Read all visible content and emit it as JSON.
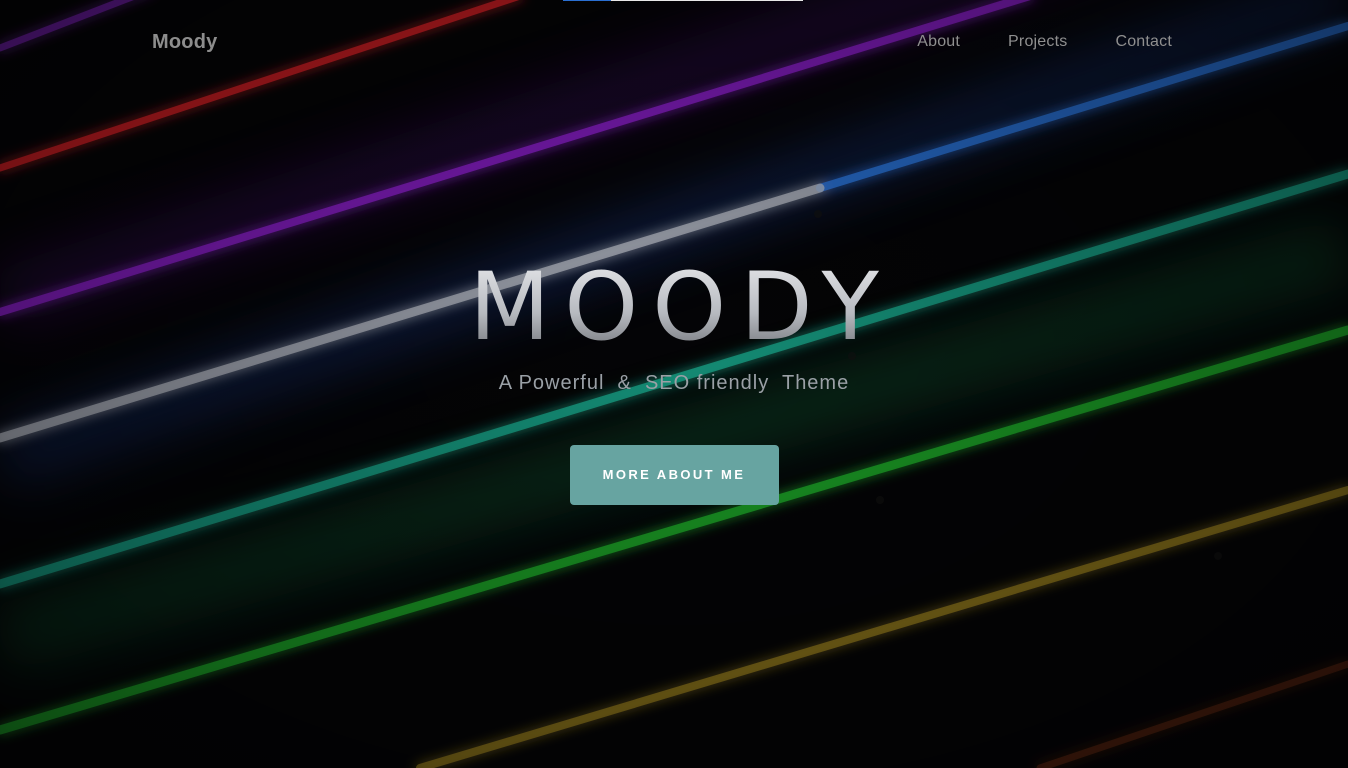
{
  "nav": {
    "brand": "Moody",
    "links": [
      "About",
      "Projects",
      "Contact"
    ]
  },
  "hero": {
    "title": "MOODY",
    "subtitle": "A Powerful  &  SEO friendly  Theme",
    "cta_label": "MORE ABOUT ME"
  },
  "top_progress": {
    "progress_fraction": 0.2
  },
  "colors": {
    "background": "#050507",
    "accent_button": "#67a4a1",
    "nav_text": "#8f8f8f",
    "neon_red": "#e0202a",
    "neon_purple": "#8a1fc9",
    "neon_blue": "#2a6fd1",
    "neon_white": "#c9ccd4",
    "neon_teal": "#1aa58a",
    "neon_green": "#22b82e",
    "neon_yellow": "#c7a52a"
  }
}
